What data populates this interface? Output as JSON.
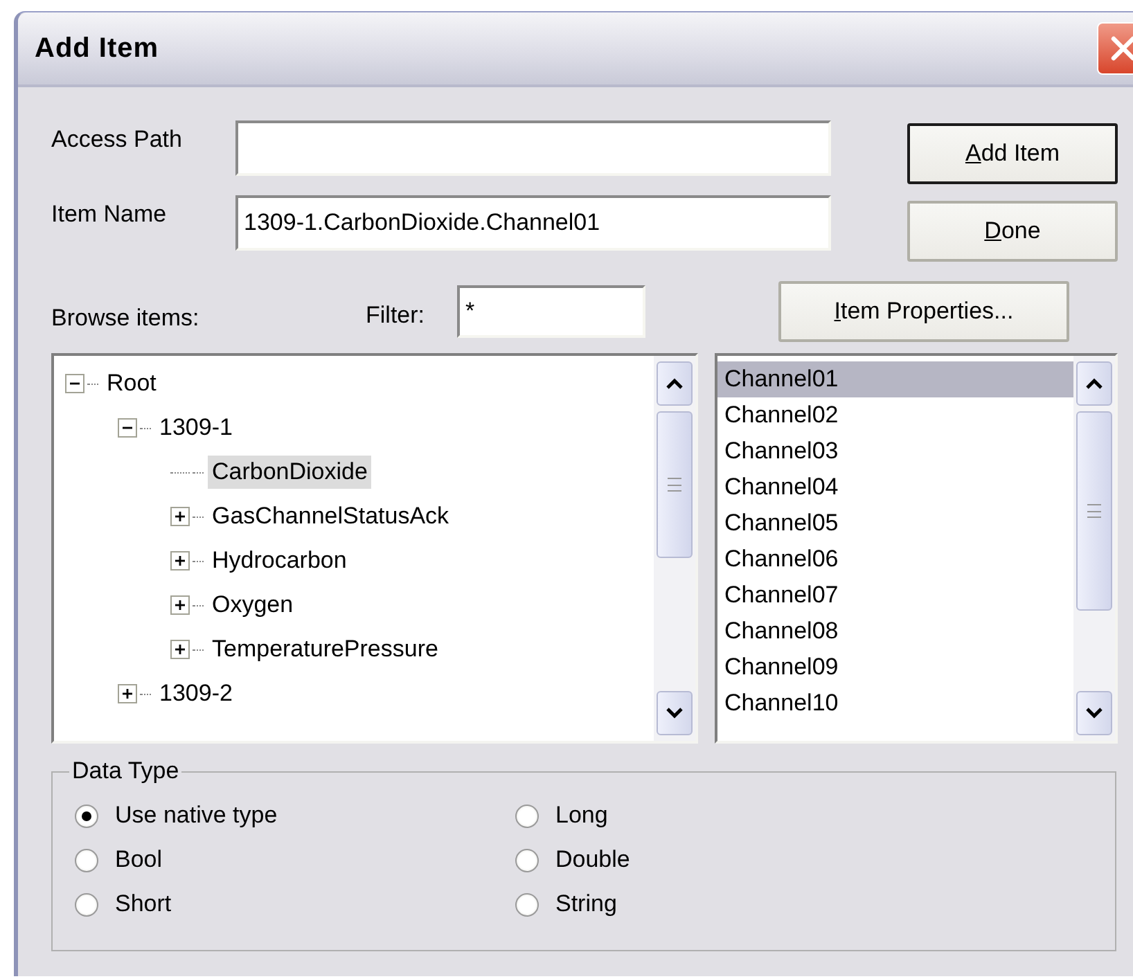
{
  "window": {
    "title": "Add Item"
  },
  "fields": [
    {
      "label": "Access Path"
    },
    {
      "label": "Item Name",
      "value": "1309-1.CarbonDioxide.Channel01"
    }
  ],
  "buttons": [
    {
      "label": "Add Item",
      "underline_first": true,
      "default": true
    },
    {
      "label": "Done",
      "underline_first": true,
      "default": false
    }
  ],
  "browse_label": "Browse items:",
  "filter": {
    "label": "Filter:",
    "value": "*"
  },
  "properties_button": {
    "label": "Item Properties...",
    "underline_first": true
  },
  "tree": [
    {
      "label": "Root",
      "kind": "branch",
      "expanded": true,
      "selected": false,
      "children": [
        {
          "label": "1309-1",
          "kind": "branch",
          "expanded": true,
          "selected": false,
          "children": [
            {
              "label": "CarbonDioxide",
              "kind": "leaf",
              "selected": true
            },
            {
              "label": "GasChannelStatusAck",
              "kind": "branch",
              "expanded": false,
              "selected": false
            },
            {
              "label": "Hydrocarbon",
              "kind": "branch",
              "expanded": false,
              "selected": false
            },
            {
              "label": "Oxygen",
              "kind": "branch",
              "expanded": false,
              "selected": false
            },
            {
              "label": "TemperaturePressure",
              "kind": "branch",
              "expanded": false,
              "selected": false
            }
          ]
        },
        {
          "label": "1309-2",
          "kind": "branch",
          "expanded": false,
          "selected": false
        }
      ]
    }
  ],
  "items": [
    {
      "label": "Channel01",
      "selected": true
    },
    {
      "label": "Channel02",
      "selected": false
    },
    {
      "label": "Channel03",
      "selected": false
    },
    {
      "label": "Channel04",
      "selected": false
    },
    {
      "label": "Channel05",
      "selected": false
    },
    {
      "label": "Channel06",
      "selected": false
    },
    {
      "label": "Channel07",
      "selected": false
    },
    {
      "label": "Channel08",
      "selected": false
    },
    {
      "label": "Channel09",
      "selected": false
    },
    {
      "label": "Channel10",
      "selected": false
    }
  ],
  "datatype": {
    "title": "Data Type",
    "options": [
      {
        "label": "Use native type",
        "selected": true
      },
      {
        "label": "Bool",
        "selected": false
      },
      {
        "label": "Short",
        "selected": false
      },
      {
        "label": "Long",
        "selected": false
      },
      {
        "label": "Double",
        "selected": false
      },
      {
        "label": "String",
        "selected": false
      }
    ]
  }
}
